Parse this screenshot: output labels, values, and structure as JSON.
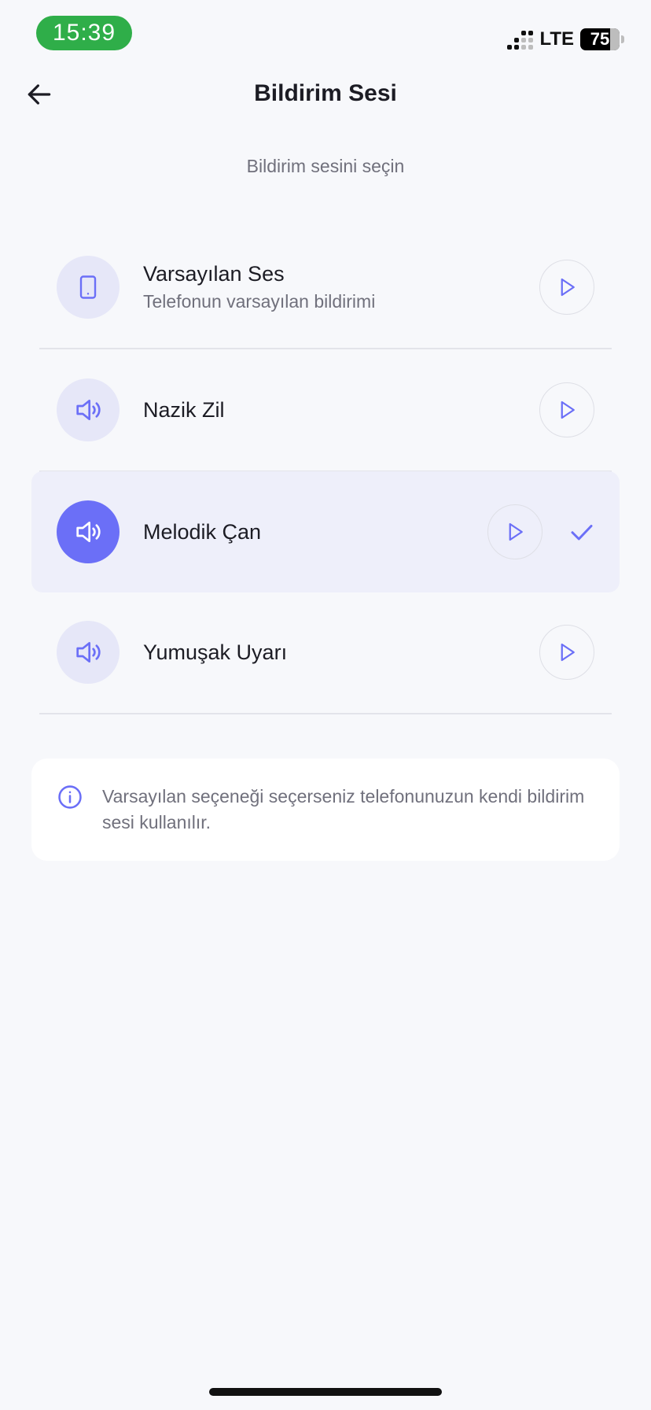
{
  "status_bar": {
    "time": "15:39",
    "network": "LTE",
    "battery": "75"
  },
  "header": {
    "title": "Bildirim Sesi"
  },
  "subtitle": "Bildirim sesini seçin",
  "sounds": [
    {
      "name": "Varsayılan Ses",
      "description": "Telefonun varsayılan bildirimi",
      "icon": "phone-icon",
      "selected": false
    },
    {
      "name": "Nazik Zil",
      "icon": "speaker-icon",
      "selected": false
    },
    {
      "name": "Melodik Çan",
      "icon": "speaker-icon",
      "selected": true
    },
    {
      "name": "Yumuşak Uyarı",
      "icon": "speaker-icon",
      "selected": false
    }
  ],
  "info": {
    "text": "Varsayılan seçeneği seçerseniz telefonunuzun kendi bildirim sesi kullanılır."
  },
  "colors": {
    "accent": "#6b6ff7",
    "accent_soft": "#e6e7f8",
    "selected_row": "#eeeffa",
    "time_pill": "#2fae49",
    "background": "#f7f8fb"
  }
}
